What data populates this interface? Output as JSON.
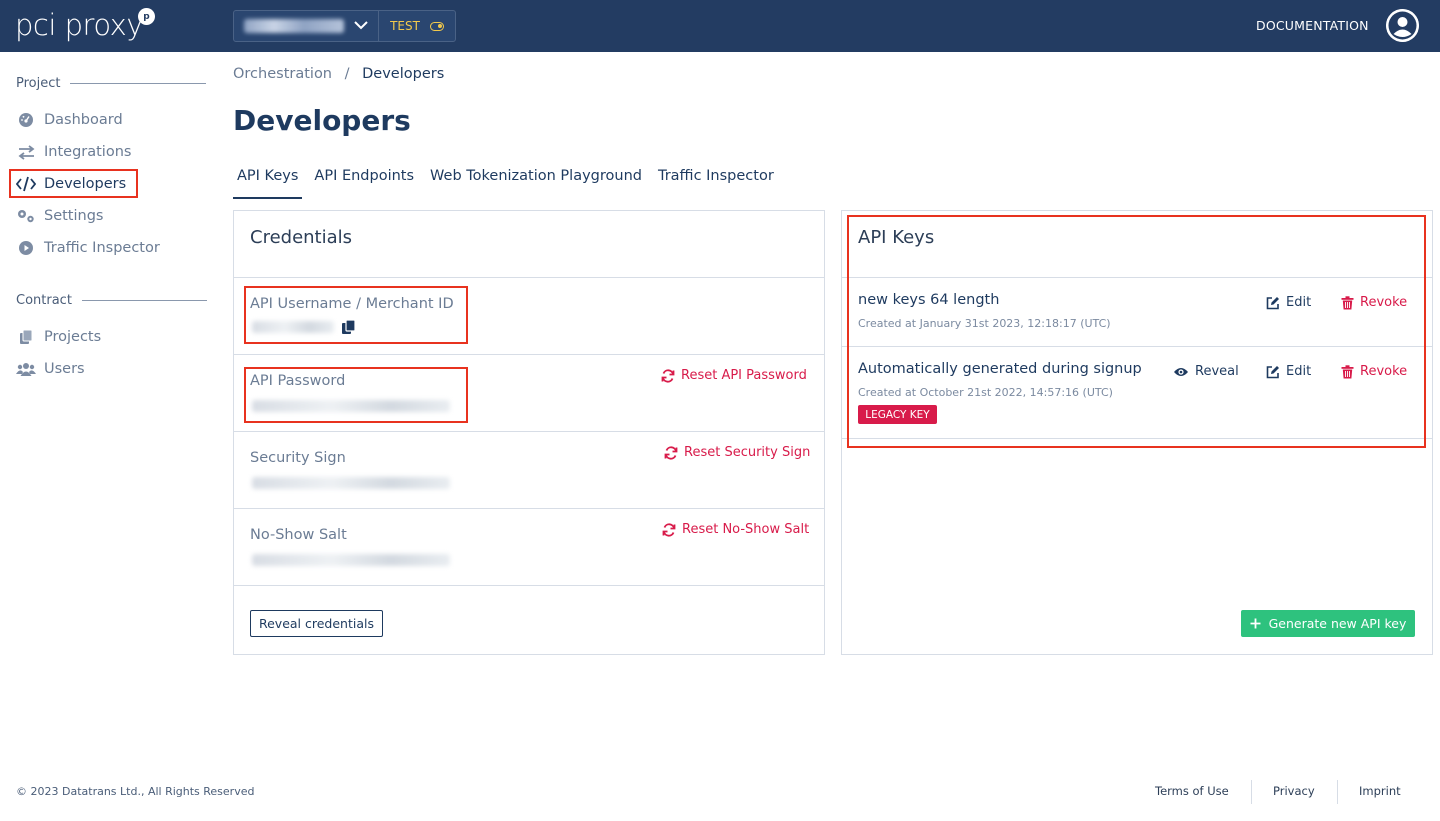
{
  "header": {
    "logo_text": "pci proxy",
    "logo_badge": "p",
    "env_mode": "TEST",
    "documentation": "DOCUMENTATION"
  },
  "sidebar": {
    "project_heading": "Project",
    "project_items": [
      {
        "label": "Dashboard",
        "icon": "dashboard-icon"
      },
      {
        "label": "Integrations",
        "icon": "arrows-exchange-icon"
      },
      {
        "label": "Developers",
        "icon": "code-icon",
        "active": true
      },
      {
        "label": "Settings",
        "icon": "gears-icon"
      },
      {
        "label": "Traffic Inspector",
        "icon": "play-circle-icon"
      }
    ],
    "contract_heading": "Contract",
    "contract_items": [
      {
        "label": "Projects",
        "icon": "copy-icon"
      },
      {
        "label": "Users",
        "icon": "users-icon"
      }
    ]
  },
  "breadcrumb": {
    "parent": "Orchestration",
    "separator": "/",
    "current": "Developers"
  },
  "page_title": "Developers",
  "tabs": [
    {
      "label": "API Keys",
      "active": true
    },
    {
      "label": "API Endpoints"
    },
    {
      "label": "Web Tokenization Playground"
    },
    {
      "label": "Traffic Inspector"
    }
  ],
  "credentials": {
    "title": "Credentials",
    "fields": [
      {
        "label": "API Username / Merchant ID"
      },
      {
        "label": "API Password",
        "action": "Reset API Password"
      },
      {
        "label": "Security Sign",
        "action": "Reset Security Sign"
      },
      {
        "label": "No-Show Salt",
        "action": "Reset No-Show Salt"
      }
    ],
    "reveal_button": "Reveal credentials"
  },
  "api_keys": {
    "title": "API Keys",
    "keys": [
      {
        "name": "new keys 64 length",
        "created": "Created at January 31st 2023, 12:18:17 (UTC)",
        "edit": "Edit",
        "revoke": "Revoke"
      },
      {
        "name": "Automatically generated during signup",
        "created": "Created at October 21st 2022, 14:57:16 (UTC)",
        "reveal": "Reveal",
        "edit": "Edit",
        "revoke": "Revoke",
        "badge": "LEGACY KEY"
      }
    ],
    "generate_button": "Generate new API key"
  },
  "footer": {
    "copyright": "© 2023 Datatrans Ltd., All Rights Reserved",
    "links": [
      "Terms of Use",
      "Privacy",
      "Imprint"
    ]
  },
  "colors": {
    "header_bg": "#233c62",
    "accent_red": "#d81b4a",
    "accent_green": "#2ec27e",
    "highlight_box": "#e8321f",
    "test_mode": "#f2c94c"
  }
}
